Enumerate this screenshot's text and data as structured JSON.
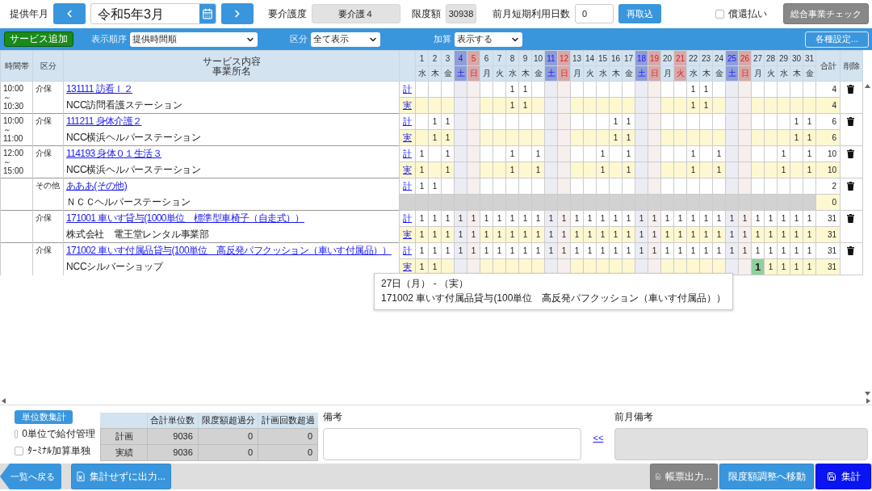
{
  "header": {
    "month_label": "提供年月",
    "month": "令和5年3月",
    "care_level_label": "要介護度",
    "care_level": "要介護４",
    "limit_label": "限度額",
    "limit": "30938",
    "prev_short_stay_label": "前月短期利用日数",
    "prev_short_stay": "0",
    "reload_button": "再取込",
    "reimbursement": {
      "label": "償還払い",
      "checked": false
    },
    "check_button": "総合事業チェック"
  },
  "toolbar": {
    "add_button": "サービス追加",
    "sort": {
      "label": "表示順序",
      "value": "提供時間順"
    },
    "category": {
      "label": "区分",
      "value": "全て表示"
    },
    "addition": {
      "label": "加算",
      "value": "表示する"
    },
    "settings_button": "各種設定..."
  },
  "columns": {
    "time": "時間帯",
    "category": "区分",
    "service": "サービス内容",
    "office": "事業所名",
    "total": "合計",
    "delete": "削除"
  },
  "days": [
    {
      "day": "1",
      "weekday": "水",
      "kind": "weekday"
    },
    {
      "day": "2",
      "weekday": "木",
      "kind": "weekday"
    },
    {
      "day": "3",
      "weekday": "金",
      "kind": "weekday"
    },
    {
      "day": "4",
      "weekday": "土",
      "kind": "sat"
    },
    {
      "day": "5",
      "weekday": "日",
      "kind": "sun"
    },
    {
      "day": "6",
      "weekday": "月",
      "kind": "weekday"
    },
    {
      "day": "7",
      "weekday": "火",
      "kind": "weekday"
    },
    {
      "day": "8",
      "weekday": "水",
      "kind": "weekday"
    },
    {
      "day": "9",
      "weekday": "木",
      "kind": "weekday"
    },
    {
      "day": "10",
      "weekday": "金",
      "kind": "weekday"
    },
    {
      "day": "11",
      "weekday": "土",
      "kind": "sat"
    },
    {
      "day": "12",
      "weekday": "日",
      "kind": "sun"
    },
    {
      "day": "13",
      "weekday": "月",
      "kind": "weekday"
    },
    {
      "day": "14",
      "weekday": "火",
      "kind": "weekday"
    },
    {
      "day": "15",
      "weekday": "水",
      "kind": "weekday"
    },
    {
      "day": "16",
      "weekday": "木",
      "kind": "weekday"
    },
    {
      "day": "17",
      "weekday": "金",
      "kind": "weekday"
    },
    {
      "day": "18",
      "weekday": "土",
      "kind": "sat"
    },
    {
      "day": "19",
      "weekday": "日",
      "kind": "sun"
    },
    {
      "day": "20",
      "weekday": "月",
      "kind": "weekday"
    },
    {
      "day": "21",
      "weekday": "火",
      "kind": "holiday"
    },
    {
      "day": "22",
      "weekday": "水",
      "kind": "weekday"
    },
    {
      "day": "23",
      "weekday": "木",
      "kind": "weekday"
    },
    {
      "day": "24",
      "weekday": "金",
      "kind": "weekday"
    },
    {
      "day": "25",
      "weekday": "土",
      "kind": "sat"
    },
    {
      "day": "26",
      "weekday": "日",
      "kind": "sun"
    },
    {
      "day": "27",
      "weekday": "月",
      "kind": "weekday"
    },
    {
      "day": "28",
      "weekday": "火",
      "kind": "weekday"
    },
    {
      "day": "29",
      "weekday": "水",
      "kind": "weekday"
    },
    {
      "day": "30",
      "weekday": "木",
      "kind": "weekday"
    },
    {
      "day": "31",
      "weekday": "金",
      "kind": "weekday"
    }
  ],
  "services": [
    {
      "time": "10:00\n～\n10:30",
      "category": "介保",
      "name": "131111 訪看Ｉ２",
      "office": "NCC訪問看護ステーション",
      "rows": [
        {
          "kind": "plan",
          "label": "計",
          "disabled": false,
          "total": "4",
          "cells": [
            "",
            "",
            "",
            "",
            "",
            "",
            "",
            "1",
            "1",
            "",
            "",
            "",
            "",
            "",
            "",
            "",
            "",
            "",
            "",
            "",
            "",
            "1",
            "1",
            "",
            "",
            "",
            "",
            "",
            "",
            "",
            ""
          ],
          "selected": [
            false,
            false,
            false,
            false,
            false,
            false,
            false,
            false,
            false,
            false,
            false,
            false,
            false,
            false,
            false,
            false,
            false,
            false,
            false,
            false,
            false,
            false,
            false,
            false,
            false,
            false,
            false,
            false,
            false,
            false,
            false
          ]
        },
        {
          "kind": "actual",
          "label": "実",
          "disabled": false,
          "total": "4",
          "cells": [
            "",
            "",
            "",
            "",
            "",
            "",
            "",
            "1",
            "1",
            "",
            "",
            "",
            "",
            "",
            "",
            "",
            "",
            "",
            "",
            "",
            "",
            "1",
            "1",
            "",
            "",
            "",
            "",
            "",
            "",
            "",
            ""
          ],
          "selected": [
            false,
            false,
            false,
            false,
            false,
            false,
            false,
            false,
            false,
            false,
            false,
            false,
            false,
            false,
            false,
            false,
            false,
            false,
            false,
            false,
            false,
            false,
            false,
            false,
            false,
            false,
            false,
            false,
            false,
            false,
            false
          ]
        }
      ]
    },
    {
      "time": "10:00\n～\n11:00",
      "category": "介保",
      "name": "111211 身体介護２",
      "office": "NCC横浜ヘルパーステーション",
      "rows": [
        {
          "kind": "plan",
          "label": "計",
          "disabled": false,
          "total": "6",
          "cells": [
            "",
            "1",
            "1",
            "",
            "",
            "",
            "",
            "",
            "",
            "",
            "",
            "",
            "",
            "",
            "",
            "1",
            "1",
            "",
            "",
            "",
            "",
            "",
            "",
            "",
            "",
            "",
            "",
            "",
            "",
            "1",
            "1"
          ],
          "selected": [
            false,
            false,
            false,
            false,
            false,
            false,
            false,
            false,
            false,
            false,
            false,
            false,
            false,
            false,
            false,
            false,
            false,
            false,
            false,
            false,
            false,
            false,
            false,
            false,
            false,
            false,
            false,
            false,
            false,
            false,
            false
          ]
        },
        {
          "kind": "actual",
          "label": "実",
          "disabled": false,
          "total": "6",
          "cells": [
            "",
            "1",
            "1",
            "",
            "",
            "",
            "",
            "",
            "",
            "",
            "",
            "",
            "",
            "",
            "",
            "1",
            "1",
            "",
            "",
            "",
            "",
            "",
            "",
            "",
            "",
            "",
            "",
            "",
            "",
            "1",
            "1"
          ],
          "selected": [
            false,
            false,
            false,
            false,
            false,
            false,
            false,
            false,
            false,
            false,
            false,
            false,
            false,
            false,
            false,
            false,
            false,
            false,
            false,
            false,
            false,
            false,
            false,
            false,
            false,
            false,
            false,
            false,
            false,
            false,
            false
          ]
        }
      ]
    },
    {
      "time": "12:00\n～\n15:00",
      "category": "介保",
      "name": "114193 身体０１生活３",
      "office": "NCC横浜ヘルパーステーション",
      "rows": [
        {
          "kind": "plan",
          "label": "計",
          "disabled": false,
          "total": "10",
          "cells": [
            "1",
            "",
            "1",
            "",
            "",
            "",
            "",
            "1",
            "",
            "1",
            "",
            "",
            "",
            "",
            "1",
            "",
            "1",
            "",
            "",
            "",
            "",
            "1",
            "",
            "1",
            "",
            "",
            "",
            "",
            "1",
            "",
            "1"
          ],
          "selected": [
            false,
            false,
            false,
            false,
            false,
            false,
            false,
            false,
            false,
            false,
            false,
            false,
            false,
            false,
            false,
            false,
            false,
            false,
            false,
            false,
            false,
            false,
            false,
            false,
            false,
            false,
            false,
            false,
            false,
            false,
            false
          ]
        },
        {
          "kind": "actual",
          "label": "実",
          "disabled": false,
          "total": "10",
          "cells": [
            "1",
            "",
            "1",
            "",
            "",
            "",
            "",
            "1",
            "",
            "1",
            "",
            "",
            "",
            "",
            "1",
            "",
            "1",
            "",
            "",
            "",
            "",
            "1",
            "",
            "1",
            "",
            "",
            "",
            "",
            "1",
            "",
            "1"
          ],
          "selected": [
            false,
            false,
            false,
            false,
            false,
            false,
            false,
            false,
            false,
            false,
            false,
            false,
            false,
            false,
            false,
            false,
            false,
            false,
            false,
            false,
            false,
            false,
            false,
            false,
            false,
            false,
            false,
            false,
            false,
            false,
            false
          ]
        }
      ]
    },
    {
      "category": "その他",
      "name": "あああ(その他)",
      "office": "ＮＣＣヘルパーステーション",
      "rows": [
        {
          "kind": "plan",
          "label": "計",
          "disabled": false,
          "total": "2",
          "cells": [
            "1",
            "1",
            "",
            "",
            "",
            "",
            "",
            "",
            "",
            "",
            "",
            "",
            "",
            "",
            "",
            "",
            "",
            "",
            "",
            "",
            "",
            "",
            "",
            "",
            "",
            "",
            "",
            "",
            "",
            "",
            ""
          ],
          "selected": [
            false,
            false,
            false,
            false,
            false,
            false,
            false,
            false,
            false,
            false,
            false,
            false,
            false,
            false,
            false,
            false,
            false,
            false,
            false,
            false,
            false,
            false,
            false,
            false,
            false,
            false,
            false,
            false,
            false,
            false,
            false
          ]
        },
        {
          "kind": "actual",
          "disabled": true,
          "total": "0"
        }
      ]
    },
    {
      "category": "介保",
      "name": "171001 車いす貸与(1000単位　標準型車椅子（自走式））",
      "office": "株式会社　電王堂レンタル事業部",
      "rows": [
        {
          "kind": "plan",
          "label": "計",
          "disabled": false,
          "total": "31",
          "cells": [
            "1",
            "1",
            "1",
            "1",
            "1",
            "1",
            "1",
            "1",
            "1",
            "1",
            "1",
            "1",
            "1",
            "1",
            "1",
            "1",
            "1",
            "1",
            "1",
            "1",
            "1",
            "1",
            "1",
            "1",
            "1",
            "1",
            "1",
            "1",
            "1",
            "1",
            "1"
          ],
          "selected": [
            false,
            false,
            false,
            false,
            false,
            false,
            false,
            false,
            false,
            false,
            false,
            false,
            false,
            false,
            false,
            false,
            false,
            false,
            false,
            false,
            false,
            false,
            false,
            false,
            false,
            false,
            false,
            false,
            false,
            false,
            false
          ]
        },
        {
          "kind": "actual",
          "label": "実",
          "disabled": false,
          "total": "31",
          "cells": [
            "1",
            "1",
            "1",
            "1",
            "1",
            "1",
            "1",
            "1",
            "1",
            "1",
            "1",
            "1",
            "1",
            "1",
            "1",
            "1",
            "1",
            "1",
            "1",
            "1",
            "1",
            "1",
            "1",
            "1",
            "1",
            "1",
            "1",
            "1",
            "1",
            "1",
            "1"
          ],
          "selected": [
            false,
            false,
            false,
            false,
            false,
            false,
            false,
            false,
            false,
            false,
            false,
            false,
            false,
            false,
            false,
            false,
            false,
            false,
            false,
            false,
            false,
            false,
            false,
            false,
            false,
            false,
            false,
            false,
            false,
            false,
            false
          ]
        }
      ]
    },
    {
      "category": "介保",
      "name": "171002 車いす付属品貸与(100単位　高反発パフクッション（車いす付属品））",
      "office": "NCCシルバーショップ",
      "rows": [
        {
          "kind": "plan",
          "label": "計",
          "disabled": false,
          "total": "31",
          "cells": [
            "1",
            "1",
            "1",
            "1",
            "1",
            "1",
            "1",
            "1",
            "1",
            "1",
            "1",
            "1",
            "1",
            "1",
            "1",
            "1",
            "1",
            "1",
            "1",
            "1",
            "1",
            "1",
            "1",
            "1",
            "1",
            "1",
            "1",
            "1",
            "1",
            "1",
            "1"
          ],
          "selected": [
            false,
            false,
            false,
            false,
            false,
            false,
            false,
            false,
            false,
            false,
            false,
            false,
            false,
            false,
            false,
            false,
            false,
            false,
            false,
            false,
            false,
            false,
            false,
            false,
            false,
            false,
            false,
            false,
            false,
            false,
            false
          ]
        },
        {
          "kind": "actual",
          "label": "実",
          "disabled": false,
          "total": "31",
          "cells": [
            "1",
            "1",
            "",
            "",
            "",
            "",
            "",
            "",
            "",
            "",
            "",
            "",
            "",
            "",
            "",
            "",
            "",
            "",
            "",
            "",
            "",
            "",
            "",
            "",
            "",
            "",
            "1",
            "1",
            "1",
            "1",
            "1"
          ],
          "selected": [
            false,
            false,
            false,
            false,
            false,
            false,
            false,
            false,
            false,
            false,
            false,
            false,
            false,
            false,
            false,
            false,
            false,
            false,
            false,
            false,
            false,
            false,
            false,
            false,
            false,
            false,
            true,
            false,
            false,
            false,
            false
          ]
        }
      ]
    }
  ],
  "tooltip": {
    "title": "27日（月） - （実）",
    "text": "171002 車いす付属品貸与(100単位　高反発パフクッション（車いす付属品））"
  },
  "summary": {
    "button": "単位数集計",
    "zero_unit": {
      "label": "0単位で給付管理",
      "checked": false
    },
    "terminal": {
      "label": "ﾀｰﾐﾅﾙ加算単独",
      "checked": false
    },
    "columns": [
      "合計単位数",
      "限度額超過分",
      "計画回数超過"
    ],
    "rows": [
      {
        "label": "計画",
        "values": [
          "9036",
          "0",
          "0"
        ]
      },
      {
        "label": "実績",
        "values": [
          "9036",
          "0",
          "0"
        ]
      }
    ]
  },
  "notes": {
    "label": "備考",
    "copy_link": "<<",
    "prev_label": "前月備考"
  },
  "footer": {
    "back_button": "一覧へ戻る",
    "export_raw_button": "集計せずに出力...",
    "report_button": "帳票出力...",
    "limit_adjust_button": "限度額調整へ移動",
    "aggregate_button": "集計"
  }
}
